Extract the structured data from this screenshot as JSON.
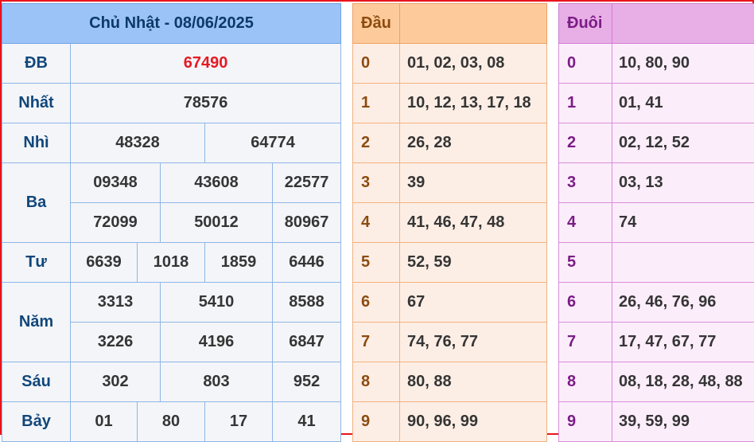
{
  "results": {
    "title": "Chủ Nhật - 08/06/2025",
    "rows": [
      {
        "label": "ĐB",
        "values": [
          "67490"
        ]
      },
      {
        "label": "Nhất",
        "values": [
          "78576"
        ]
      },
      {
        "label": "Nhì",
        "values": [
          "48328",
          "64774"
        ]
      },
      {
        "label": "Ba",
        "values": [
          "09348",
          "43608",
          "22577",
          "72099",
          "50012",
          "80967"
        ]
      },
      {
        "label": "Tư",
        "values": [
          "6639",
          "1018",
          "1859",
          "6446"
        ]
      },
      {
        "label": "Năm",
        "values": [
          "3313",
          "5410",
          "8588",
          "3226",
          "4196",
          "6847"
        ]
      },
      {
        "label": "Sáu",
        "values": [
          "302",
          "803",
          "952"
        ]
      },
      {
        "label": "Bảy",
        "values": [
          "01",
          "80",
          "17",
          "41"
        ]
      }
    ]
  },
  "dau": {
    "header": "Đầu",
    "rows": [
      {
        "digit": "0",
        "values": "01, 02, 03, 08"
      },
      {
        "digit": "1",
        "values": "10, 12, 13, 17, 18"
      },
      {
        "digit": "2",
        "values": "26, 28"
      },
      {
        "digit": "3",
        "values": "39"
      },
      {
        "digit": "4",
        "values": "41, 46, 47, 48"
      },
      {
        "digit": "5",
        "values": "52, 59"
      },
      {
        "digit": "6",
        "values": "67"
      },
      {
        "digit": "7",
        "values": "74, 76, 77"
      },
      {
        "digit": "8",
        "values": "80, 88"
      },
      {
        "digit": "9",
        "values": "90, 96, 99"
      }
    ]
  },
  "duoi": {
    "header": "Đuôi",
    "rows": [
      {
        "digit": "0",
        "values": "10, 80, 90"
      },
      {
        "digit": "1",
        "values": "01, 41"
      },
      {
        "digit": "2",
        "values": "02, 12, 52"
      },
      {
        "digit": "3",
        "values": "03, 13"
      },
      {
        "digit": "4",
        "values": "74"
      },
      {
        "digit": "5",
        "values": ""
      },
      {
        "digit": "6",
        "values": "26, 46, 76, 96"
      },
      {
        "digit": "7",
        "values": "17, 47, 67, 77"
      },
      {
        "digit": "8",
        "values": "08, 18, 28, 48, 88"
      },
      {
        "digit": "9",
        "values": "39, 59, 99"
      }
    ]
  },
  "colors": {
    "frame_border": "#e8141d",
    "special_prize": "#e51a22",
    "results_header": "#9cc3f7",
    "dau_header": "#fdcb9b",
    "duoi_header": "#e8aee6"
  }
}
